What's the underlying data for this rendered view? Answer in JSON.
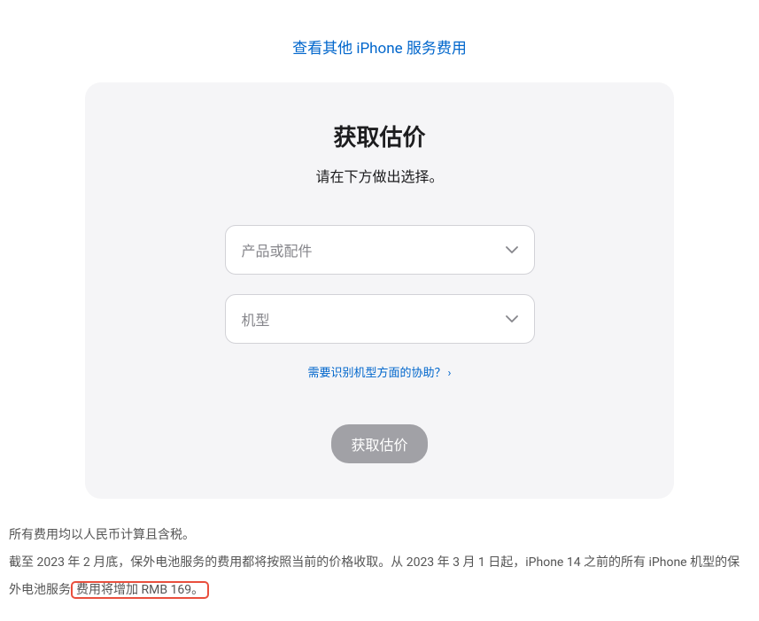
{
  "topLink": {
    "label": "查看其他 iPhone 服务费用"
  },
  "card": {
    "title": "获取估价",
    "subtitle": "请在下方做出选择。",
    "product": {
      "placeholder": "产品或配件"
    },
    "model": {
      "placeholder": "机型"
    },
    "help": {
      "label": "需要识别机型方面的协助？"
    },
    "submit": {
      "label": "获取估价"
    }
  },
  "footnotes": {
    "line1": "所有费用均以人民币计算且含税。",
    "line2_prefix": "截至 2023 年 2 月底，保外电池服务的费用都将按照当前的价格收取。从 2023 年 3 月 1 日起，iPhone 14 之前的所有 iPhone 机型的保外电池服务",
    "line2_highlight": "费用将增加 RMB 169。"
  }
}
